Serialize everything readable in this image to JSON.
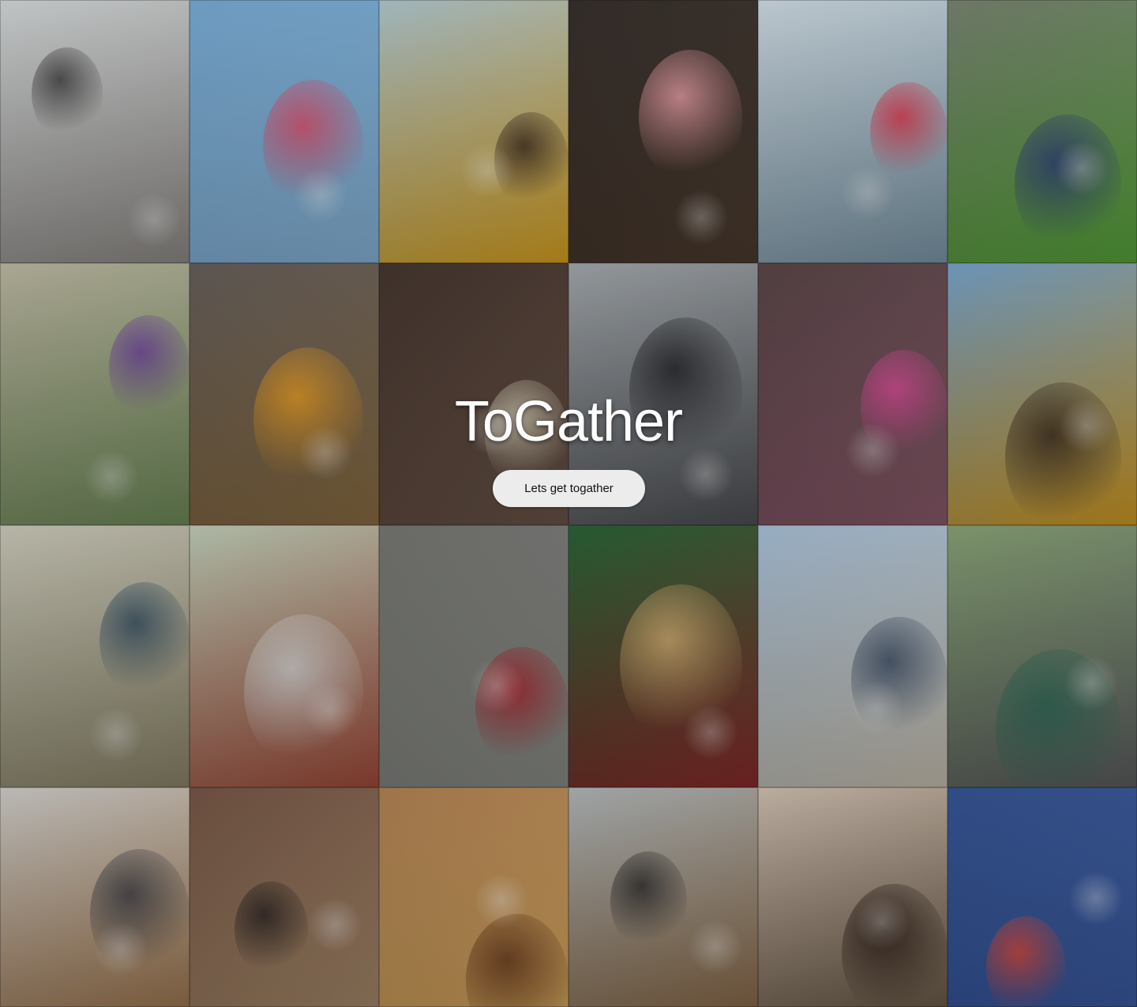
{
  "hero": {
    "title": "ToGather",
    "button_label": "Lets get togather"
  },
  "photos": [
    {
      "id": "friends-dancing",
      "bg": [
        "#cfd3d4",
        "#8e8a86"
      ],
      "accent": "#3c3a3a"
    },
    {
      "id": "balloons-sky",
      "bg": [
        "#6fa4cf",
        "#88b5d9"
      ],
      "accent": "#e44b6a"
    },
    {
      "id": "sunflower-girl",
      "bg": [
        "#a9c1c9",
        "#d9a21f"
      ],
      "accent": "#3e2b1d"
    },
    {
      "id": "sparkler-bokeh",
      "bg": [
        "#2b2420",
        "#4c3b2e"
      ],
      "accent": "#f0a0a8"
    },
    {
      "id": "boy-red-shirt",
      "bg": [
        "#c9d6de",
        "#7b97a8"
      ],
      "accent": "#e2334a"
    },
    {
      "id": "kids-guitar-grass",
      "bg": [
        "#6f7a68",
        "#57a53a"
      ],
      "accent": "#2c3f7a"
    },
    {
      "id": "woman-purple-scarf",
      "bg": [
        "#b5b09a",
        "#6e8a58"
      ],
      "accent": "#6a3d9a"
    },
    {
      "id": "men-laughing-costume",
      "bg": [
        "#5a5350",
        "#8a6c40"
      ],
      "accent": "#f0a020"
    },
    {
      "id": "wine-glasses",
      "bg": [
        "#3a2a22",
        "#6a5448"
      ],
      "accent": "#d8d0b8"
    },
    {
      "id": "three-friends-fence",
      "bg": [
        "#9aa0a4",
        "#4c4e52"
      ],
      "accent": "#1e1e22"
    },
    {
      "id": "holi-girl",
      "bg": [
        "#4e3a3c",
        "#8a5a6a"
      ],
      "accent": "#e04a9a"
    },
    {
      "id": "woman-sunflowers",
      "bg": [
        "#6d9bc4",
        "#d29a20"
      ],
      "accent": "#3a2a1c"
    },
    {
      "id": "man-reeds-sunglasses",
      "bg": [
        "#c4c2b2",
        "#8a8468"
      ],
      "accent": "#2f4a5e"
    },
    {
      "id": "picnic-table",
      "bg": [
        "#b8c6b0",
        "#a04a38"
      ],
      "accent": "#d8d8d8"
    },
    {
      "id": "dragon-boat",
      "bg": [
        "#6b6c68",
        "#8a8c86"
      ],
      "accent": "#b0202a"
    },
    {
      "id": "wedding-couple",
      "bg": [
        "#1c5a2a",
        "#8a2a2a"
      ],
      "accent": "#d8b070"
    },
    {
      "id": "family-beach",
      "bg": [
        "#9fb8d0",
        "#c8c0b0"
      ],
      "accent": "#3a4a62"
    },
    {
      "id": "swings-park",
      "bg": [
        "#7e9a6c",
        "#5a5c5e"
      ],
      "accent": "#2c6a58"
    },
    {
      "id": "two-women-hug",
      "bg": [
        "#c8c6c2",
        "#a07850"
      ],
      "accent": "#3a3a40"
    },
    {
      "id": "kids-peace-sign",
      "bg": [
        "#6a4a3a",
        "#a88a6a"
      ],
      "accent": "#2a2220"
    },
    {
      "id": "woman-sunlight",
      "bg": [
        "#a87848",
        "#d8a860"
      ],
      "accent": "#6a3a1a"
    },
    {
      "id": "man-ukulele",
      "bg": [
        "#a8aeb0",
        "#8a6a48"
      ],
      "accent": "#2a2828"
    },
    {
      "id": "man-city-street",
      "bg": [
        "#c8b8a8",
        "#6a5a48"
      ],
      "accent": "#2a1a12"
    },
    {
      "id": "balloons-blue-sky",
      "bg": [
        "#2a4a8a",
        "#3a5aa0"
      ],
      "accent": "#e44a3a"
    }
  ]
}
